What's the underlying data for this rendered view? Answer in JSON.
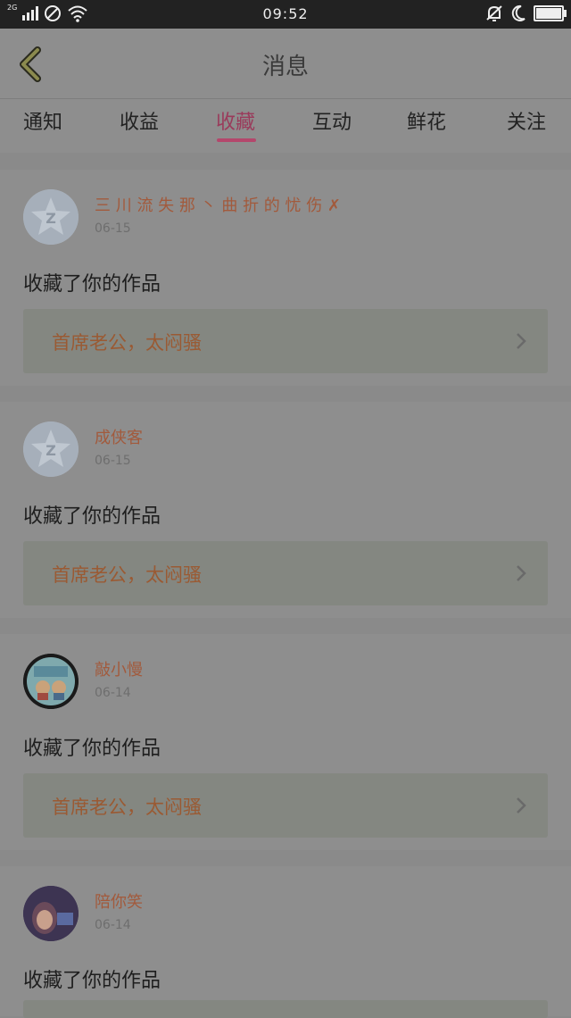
{
  "status_bar": {
    "network_label": "2G",
    "time": "09:52",
    "icons": [
      "signal-icon",
      "no-sim-icon",
      "wifi-icon",
      "bell-muted-icon",
      "moon-icon",
      "battery-icon"
    ]
  },
  "header": {
    "back_icon": "back-chevron-icon",
    "title": "消息"
  },
  "tabs": [
    {
      "label": "通知",
      "active": false
    },
    {
      "label": "收益",
      "active": false
    },
    {
      "label": "收藏",
      "active": true
    },
    {
      "label": "互动",
      "active": false
    },
    {
      "label": "鲜花",
      "active": false
    },
    {
      "label": "关注",
      "active": false
    }
  ],
  "messages": [
    {
      "user": "三 川 流 失 那 丶 曲 折 的 忧 伤 ✗",
      "date": "06-15",
      "action": "收藏了你的作品",
      "work_title": "首席老公，太闷骚",
      "avatar": "default-qq-avatar"
    },
    {
      "user": "成侠客",
      "date": "06-15",
      "action": "收藏了你的作品",
      "work_title": "首席老公，太闷骚",
      "avatar": "default-qq-avatar"
    },
    {
      "user": "敲小慢",
      "date": "06-14",
      "action": "收藏了你的作品",
      "work_title": "首席老公，太闷骚",
      "avatar": "cartoon-photo-avatar"
    },
    {
      "user": "陪你笑",
      "date": "06-14",
      "action": "收藏了你的作品",
      "work_title": "",
      "avatar": "selfie-photo-avatar"
    }
  ],
  "colors": {
    "overlay_bg": "#8e8e8e",
    "active_tab": "#b4476c",
    "username": "#a25a3c",
    "work_title": "#9a5a33"
  }
}
